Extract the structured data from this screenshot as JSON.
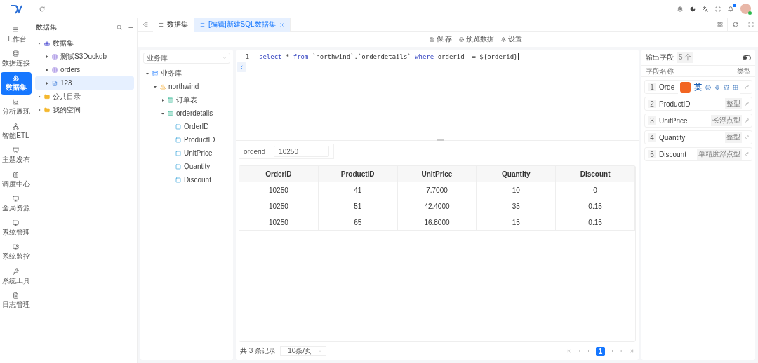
{
  "nav": [
    {
      "label": "工作台",
      "selected": false
    },
    {
      "label": "数据连接",
      "selected": false
    },
    {
      "label": "数据集",
      "selected": true
    },
    {
      "label": "分析展现",
      "selected": false
    },
    {
      "label": "智能ETL",
      "selected": false
    },
    {
      "label": "主题发布",
      "selected": false
    },
    {
      "label": "调度中心",
      "selected": false
    },
    {
      "label": "全局资源",
      "selected": false
    },
    {
      "label": "系统管理",
      "selected": false
    },
    {
      "label": "系统监控",
      "selected": false
    },
    {
      "label": "系统工具",
      "selected": false
    },
    {
      "label": "日志管理",
      "selected": false
    }
  ],
  "dataset_panel": {
    "title": "数据集",
    "tree": [
      {
        "label": "数据集",
        "kind": "dataset",
        "expanded": true,
        "selected": false,
        "children": [
          {
            "label": "测试S3Duckdb",
            "kind": "table",
            "expanded": false,
            "selected": false
          },
          {
            "label": "orders",
            "kind": "table",
            "expanded": false,
            "selected": false
          },
          {
            "label": "123",
            "kind": "sql",
            "expanded": false,
            "selected": true
          }
        ]
      },
      {
        "label": "公共目录",
        "kind": "folder",
        "expanded": false,
        "selected": false
      },
      {
        "label": "我的空间",
        "kind": "folder",
        "expanded": false,
        "selected": false
      }
    ]
  },
  "tabs": [
    {
      "label": "数据集",
      "selected": false,
      "closable": false
    },
    {
      "label": "[编辑]新建SQL数据集",
      "selected": true,
      "closable": true
    }
  ],
  "toolbar": [
    "保 存",
    "预览数据",
    "设置"
  ],
  "schema_panel": {
    "select": "业务库",
    "tree": [
      {
        "label": "业务库",
        "kind": "database",
        "expanded": true,
        "children": [
          {
            "label": "northwind",
            "kind": "schema",
            "expanded": true,
            "children": [
              {
                "label": "订单表",
                "kind": "table",
                "expanded": false
              },
              {
                "label": "orderdetails",
                "kind": "table",
                "expanded": true,
                "children": [
                  {
                    "label": "OrderID",
                    "kind": "column"
                  },
                  {
                    "label": "ProductID",
                    "kind": "column"
                  },
                  {
                    "label": "UnitPrice",
                    "kind": "column"
                  },
                  {
                    "label": "Quantity",
                    "kind": "column"
                  },
                  {
                    "label": "Discount",
                    "kind": "column"
                  }
                ]
              }
            ]
          }
        ]
      }
    ]
  },
  "editor": {
    "lines": [
      {
        "number": "1",
        "tokens": [
          {
            "text": "select",
            "kind": "keyword"
          },
          {
            "text": " * ",
            "kind": "plain"
          },
          {
            "text": "from",
            "kind": "keyword"
          },
          {
            "text": " `northwind`.`orderdetails` ",
            "kind": "plain"
          },
          {
            "text": "where",
            "kind": "keyword"
          },
          {
            "text": " orderid  = ",
            "kind": "plain"
          },
          {
            "text": "${orderid}",
            "kind": "plain"
          }
        ]
      }
    ]
  },
  "params": [
    {
      "label": "orderid",
      "value": "10250"
    }
  ],
  "table": {
    "columns": [
      "OrderID",
      "ProductID",
      "UnitPrice",
      "Quantity",
      "Discount"
    ],
    "rows": [
      [
        "10250",
        "41",
        "7.7000",
        "10",
        "0"
      ],
      [
        "10250",
        "51",
        "42.4000",
        "35",
        "0.15"
      ],
      [
        "10250",
        "65",
        "16.8000",
        "15",
        "0.15"
      ]
    ]
  },
  "pagination": {
    "total": "共 3 条记录",
    "page_size": "10条/页",
    "pages": [
      {
        "label": "1",
        "selected": true
      }
    ]
  },
  "output_fields": {
    "title": "输出字段",
    "count": "5 个",
    "on": false,
    "columns": [
      "字段名称",
      "类型"
    ],
    "fields": [
      {
        "index": "1",
        "name": "Orde"
      },
      {
        "index": "2",
        "name": "ProductID",
        "type": "整型"
      },
      {
        "index": "3",
        "name": "UnitPrice",
        "type": "长浮点型"
      },
      {
        "index": "4",
        "name": "Quantity",
        "type": "整型"
      },
      {
        "index": "5",
        "name": "Discount",
        "type": "单精度浮点型"
      }
    ]
  },
  "ime_bar": {
    "label": "英"
  }
}
